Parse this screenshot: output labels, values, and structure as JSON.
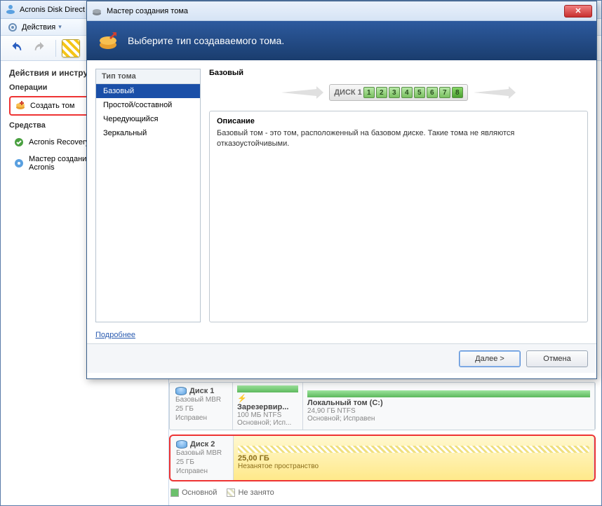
{
  "main": {
    "title": "Acronis Disk Direct",
    "actions_label": "Действия"
  },
  "sidebar": {
    "heading": "Действия и инструменты",
    "ops_label": "Операции",
    "create_volume": "Создать том",
    "tools_label": "Средства",
    "recovery": "Acronis Recovery",
    "media_builder": "Мастер создания носителей Acronis"
  },
  "disks": {
    "d1": {
      "name": "Диск 1",
      "type": "Базовый MBR",
      "size": "25 ГБ",
      "status": "Исправен"
    },
    "d1p1": {
      "name": "Зарезервир...",
      "size": "100 МБ NTFS",
      "status": "Основной; Исп..."
    },
    "d1p2": {
      "name": "Локальный том (C:)",
      "size": "24,90 ГБ NTFS",
      "status": "Основной; Исправен"
    },
    "d2": {
      "name": "Диск 2",
      "type": "Базовый MBR",
      "size": "25 ГБ",
      "status": "Исправен"
    },
    "d2p1": {
      "size": "25,00 ГБ",
      "status": "Незанятое пространство"
    },
    "legend_primary": "Основной",
    "legend_free": "Не занято"
  },
  "wizard": {
    "title": "Мастер создания тома",
    "header": "Выберите тип создаваемого тома.",
    "type_header": "Тип тома",
    "types": {
      "basic": "Базовый",
      "simple": "Простой/составной",
      "striped": "Чередующийся",
      "mirror": "Зеркальный"
    },
    "right_title": "Базовый",
    "disk_label": "ДИСК 1",
    "slots": [
      "1",
      "2",
      "3",
      "4",
      "5",
      "6",
      "7",
      "8"
    ],
    "desc_heading": "Описание",
    "desc_text": "Базовый том - это том, расположенный на базовом диске. Такие тома не являются отказоустойчивыми.",
    "more": "Подробнее",
    "next": "Далее >",
    "cancel": "Отмена"
  }
}
